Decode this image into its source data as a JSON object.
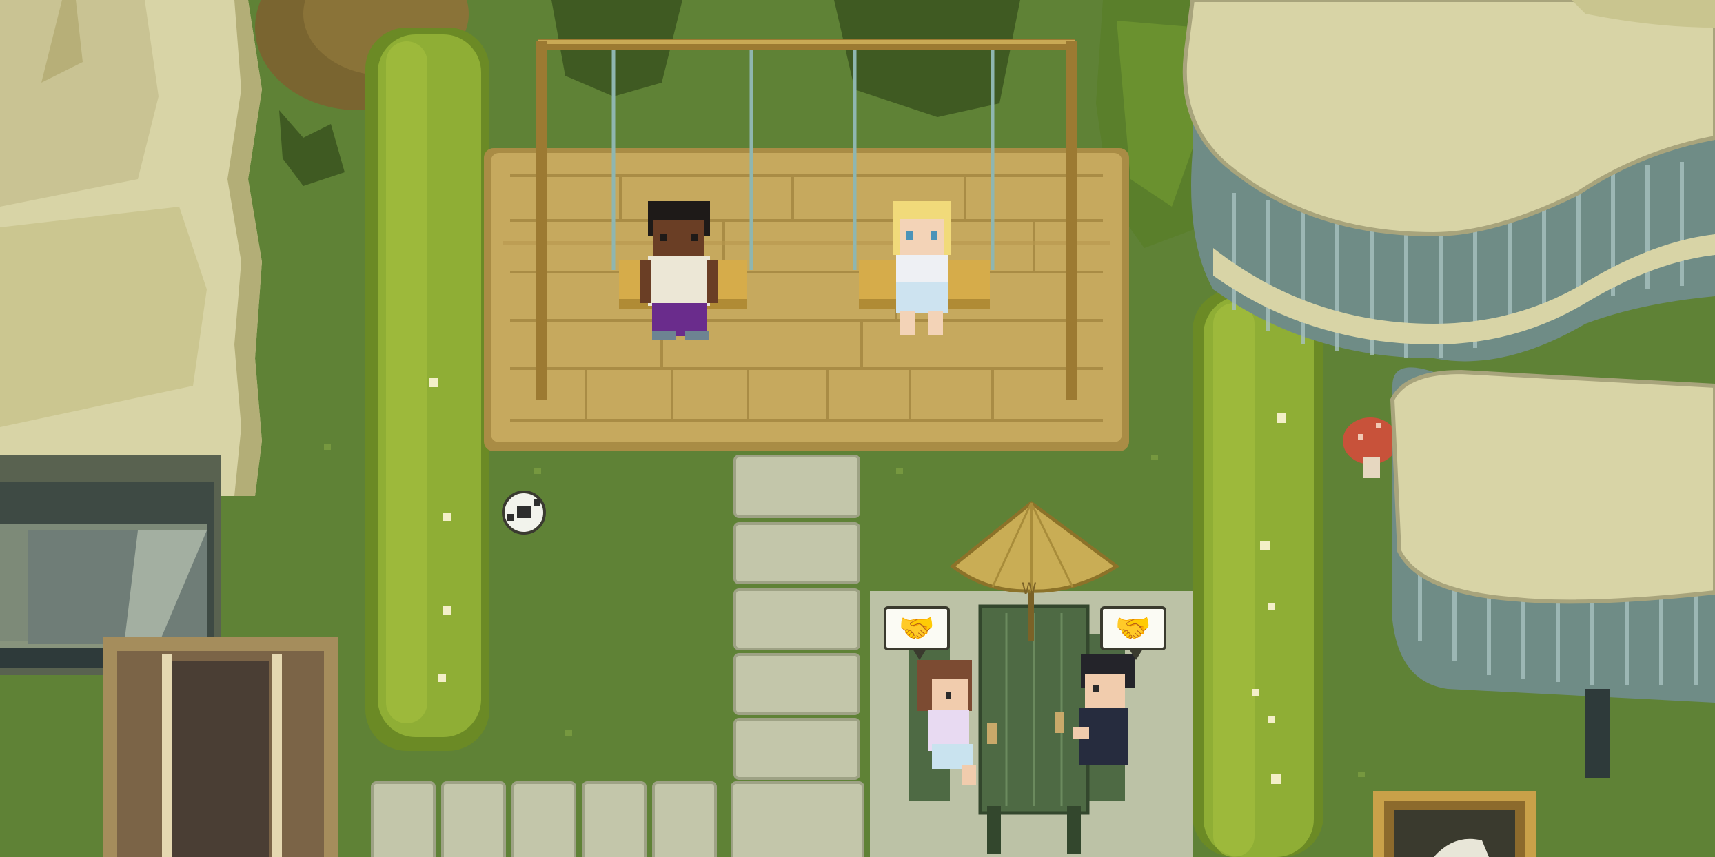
{
  "scene": {
    "type": "top-down pixel-art park",
    "palette": {
      "grass": "#5f8236",
      "grass_dark": "#4f6f2c",
      "hedge": "#8fae35",
      "hedge_dark": "#6b8a25",
      "deck": "#c6a95e",
      "deck_dark": "#a98c45",
      "stone": "#c3c6aa",
      "swing_frame": "#9c7a32",
      "swing_rope": "#8fb6b0",
      "table": "#4e6a44",
      "umbrella": "#c9ad55",
      "building_roof": "#d8d4a6",
      "building_glass": "#7b9aa1",
      "mushroom": "#c8523a"
    }
  },
  "characters": [
    {
      "name": "boy-on-swing",
      "hair": "#1e1a18",
      "skin": "#6a3e25",
      "shirt": "#ece7d6",
      "pants": "#6a2c8c"
    },
    {
      "name": "girl-on-swing",
      "hair": "#f1da7a",
      "skin": "#f3d3b7",
      "shirt": "#eef0f4",
      "skirt": "#cde3f0"
    },
    {
      "name": "girl-at-table",
      "hair": "#7c4b32",
      "skin": "#f1ccad",
      "shirt": "#e8daf2"
    },
    {
      "name": "man-at-table",
      "hair": "#24242a",
      "skin": "#f1ccad",
      "suit": "#262c3e"
    }
  ],
  "bubbles": [
    {
      "name": "handshake-bubble-left",
      "glyph": "🤝"
    },
    {
      "name": "handshake-bubble-right",
      "glyph": "🤝"
    }
  ],
  "umbrella_mark": "W"
}
